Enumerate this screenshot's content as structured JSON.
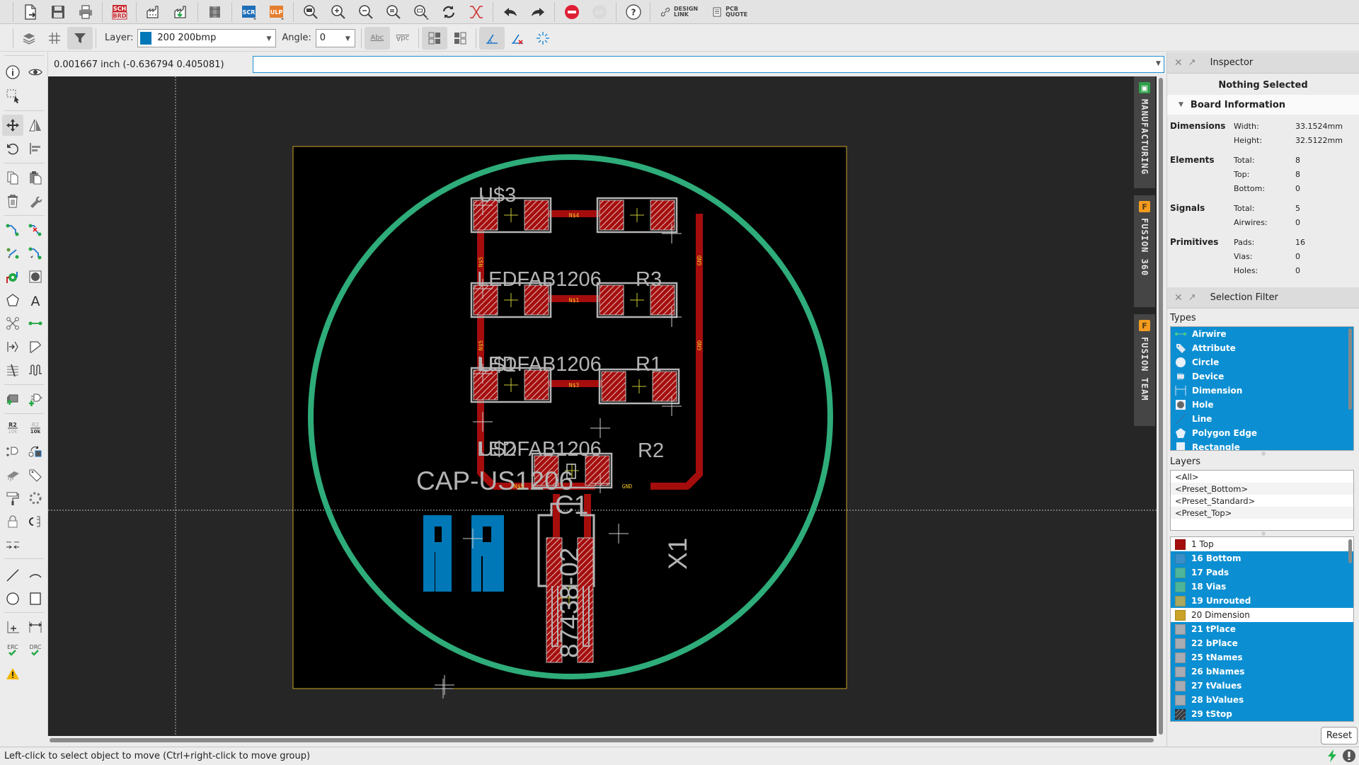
{
  "toolbar_top": {
    "buttons": [
      {
        "name": "open-button",
        "icon": "open-file-icon"
      },
      {
        "name": "save-button",
        "icon": "save-icon"
      },
      {
        "name": "print-button",
        "icon": "print-icon"
      },
      {
        "name": "sch-brd-switch-button",
        "icon": "sch-brd-icon",
        "label_top": "SCH",
        "label_bottom": "BRD"
      },
      {
        "name": "cam-processor-button",
        "icon": "factory-icon"
      },
      {
        "name": "manufacturing-export-button",
        "icon": "factory-download-icon"
      },
      {
        "name": "library-button",
        "icon": "library-books-icon"
      },
      {
        "name": "script-button",
        "icon": "script-icon",
        "label": "SCR"
      },
      {
        "name": "ulp-button",
        "icon": "ulp-icon",
        "label": "ULP"
      },
      {
        "name": "zoom-fit-button",
        "icon": "zoom-fit-icon"
      },
      {
        "name": "zoom-in-button",
        "icon": "zoom-in-icon"
      },
      {
        "name": "zoom-out-button",
        "icon": "zoom-out-icon"
      },
      {
        "name": "zoom-redraw-button",
        "icon": "zoom-redraw-icon"
      },
      {
        "name": "zoom-select-button",
        "icon": "zoom-select-icon"
      },
      {
        "name": "redraw-button",
        "icon": "refresh-icon"
      },
      {
        "name": "ratsnest-button",
        "icon": "ratsnest-icon"
      },
      {
        "name": "undo-button",
        "icon": "undo-icon"
      },
      {
        "name": "redo-button",
        "icon": "redo-icon"
      },
      {
        "name": "stop-button",
        "icon": "stop-icon"
      },
      {
        "name": "go-button",
        "icon": "go-icon",
        "label": "GO"
      },
      {
        "name": "help-button",
        "icon": "help-icon",
        "label": "?"
      }
    ],
    "design_link": {
      "line1": "DESIGN",
      "line2": "LINK"
    },
    "pcb_quote": {
      "line1": "PCB",
      "line2": "QUOTE"
    }
  },
  "toolbar_params": {
    "layer_label": "Layer:",
    "layer_value": "200 200bmp",
    "layer_color": "#0077b6",
    "angle_label": "Angle:",
    "angle_value": "0",
    "text_normal_label": "Abc",
    "text_mirror_label": "Abc"
  },
  "coordinates": {
    "readout": "0.001667 inch (-0.636794 0.405081)",
    "command_value": "",
    "command_placeholder": ""
  },
  "side_tabs": [
    {
      "label": "MANUFACTURING",
      "icon": "chip-icon",
      "color": "#2e9e4a"
    },
    {
      "label": "FUSION 360",
      "icon": "fusion-icon",
      "color": "#f39c1f"
    },
    {
      "label": "FUSION TEAM",
      "icon": "fusion-icon",
      "color": "#f39c1f"
    }
  ],
  "board": {
    "parts": [
      {
        "name": "U$3",
        "value": "LEDFAB1206"
      },
      {
        "name": "R3",
        "value": ""
      },
      {
        "name": "U$1",
        "value": "LEDFAB1206"
      },
      {
        "name": "R1",
        "value": ""
      },
      {
        "name": "U$2",
        "value": "LEDFAB1206"
      },
      {
        "name": "R2",
        "value": ""
      },
      {
        "name": "C1",
        "value": "CAP-US1206"
      },
      {
        "name": "X1",
        "value": "87438-02"
      }
    ],
    "nets": [
      "N$4",
      "N$1",
      "N$3",
      "N$5",
      "GND"
    ],
    "logo_text": "AR",
    "colors": {
      "background": "#000000",
      "outer": "#262626",
      "dimension": "#c9a227",
      "copper_top": "#a50d0d",
      "pad": "#c8a0a0",
      "silk": "#b4b4b4",
      "milling": "#2eac7a",
      "bmp": "#0077b6",
      "origin": "#c8c832",
      "net_label": "#e8c020"
    }
  },
  "inspector": {
    "title": "Inspector",
    "status": "Nothing Selected",
    "section_title": "Board Information",
    "groups": [
      {
        "label": "Dimensions",
        "rows": [
          {
            "k": "Width:",
            "v": "33.1524mm"
          },
          {
            "k": "Height:",
            "v": "32.5122mm"
          }
        ]
      },
      {
        "label": "Elements",
        "rows": [
          {
            "k": "Total:",
            "v": "8"
          },
          {
            "k": "Top:",
            "v": "8"
          },
          {
            "k": "Bottom:",
            "v": "0"
          }
        ]
      },
      {
        "label": "Signals",
        "rows": [
          {
            "k": "Total:",
            "v": "5"
          },
          {
            "k": "Airwires:",
            "v": "0"
          }
        ]
      },
      {
        "label": "Primitives",
        "rows": [
          {
            "k": "Pads:",
            "v": "16"
          },
          {
            "k": "Vias:",
            "v": "0"
          },
          {
            "k": "Holes:",
            "v": "0"
          }
        ]
      }
    ]
  },
  "selection_filter": {
    "title": "Selection Filter",
    "types_label": "Types",
    "types": [
      {
        "label": "Airwire",
        "icon": "airwire-icon",
        "selected": true
      },
      {
        "label": "Attribute",
        "icon": "tag-icon",
        "selected": true
      },
      {
        "label": "Circle",
        "icon": "circle-icon",
        "selected": true
      },
      {
        "label": "Device",
        "icon": "device-icon",
        "selected": true
      },
      {
        "label": "Dimension",
        "icon": "dimension-icon",
        "selected": true
      },
      {
        "label": "Hole",
        "icon": "hole-icon",
        "selected": true
      },
      {
        "label": "Line",
        "icon": "line-icon",
        "selected": true
      },
      {
        "label": "Polygon Edge",
        "icon": "polygon-icon",
        "selected": true
      },
      {
        "label": "Rectangle",
        "icon": "rectangle-icon",
        "selected": true
      }
    ],
    "layers_label": "Layers",
    "presets": [
      "<All>",
      "<Preset_Bottom>",
      "<Preset_Standard>",
      "<Preset_Top>"
    ],
    "layers": [
      {
        "label": "1 Top",
        "color": "#a50d0d",
        "selected": false
      },
      {
        "label": "16 Bottom",
        "color": "#3a8fc8",
        "selected": true
      },
      {
        "label": "17 Pads",
        "color": "#4fb59a",
        "selected": true
      },
      {
        "label": "18 Vias",
        "color": "#4fb59a",
        "selected": true
      },
      {
        "label": "19 Unrouted",
        "color": "#a9a85e",
        "selected": true
      },
      {
        "label": "20 Dimension",
        "color": "#c9a227",
        "selected": false
      },
      {
        "label": "21 tPlace",
        "color": "#a7abb2",
        "selected": true
      },
      {
        "label": "22 bPlace",
        "color": "#a7abb2",
        "selected": true
      },
      {
        "label": "25 tNames",
        "color": "#a7abb2",
        "selected": true
      },
      {
        "label": "26 bNames",
        "color": "#a7abb2",
        "selected": true
      },
      {
        "label": "27 tValues",
        "color": "#a7abb2",
        "selected": true
      },
      {
        "label": "28 bValues",
        "color": "#a7abb2",
        "selected": true
      },
      {
        "label": "29 tStop",
        "color": "#333a40",
        "selected": true
      }
    ],
    "reset_label": "Reset"
  },
  "status_bar": {
    "message": "Left-click to select object to move (Ctrl+right-click to move group)"
  }
}
